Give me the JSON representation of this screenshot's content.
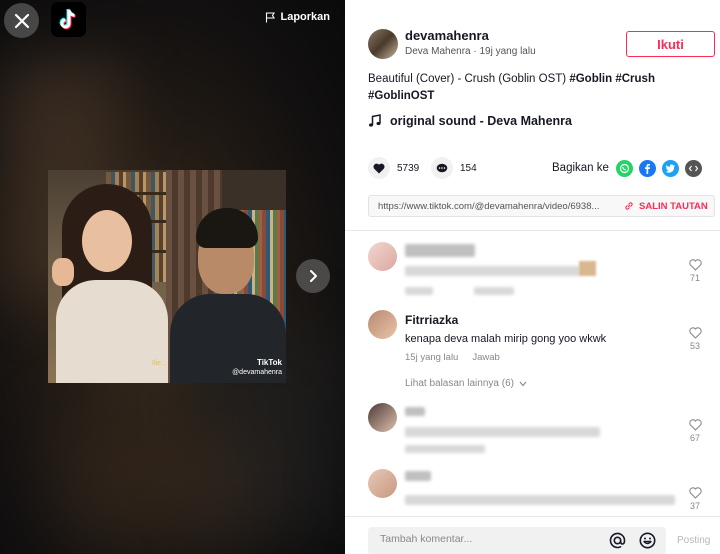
{
  "player": {
    "report_label": "Laporkan",
    "watermark_brand": "TikTok",
    "watermark_handle": "@devamahenra",
    "subtitle": "Ilie..."
  },
  "author": {
    "username": "devamahenra",
    "meta": "Deva Mahenra · 19j yang lalu",
    "follow_label": "Ikuti"
  },
  "description": {
    "text": "Beautiful (Cover) - Crush (Goblin OST)",
    "tags": [
      "#Goblin",
      "#Crush",
      "#GoblinOST"
    ]
  },
  "sound": {
    "title": "original sound - Deva Mahenra"
  },
  "stats": {
    "likes": "5739",
    "comments": "154"
  },
  "share": {
    "label": "Bagikan ke",
    "icons": [
      "whatsapp-icon",
      "facebook-icon",
      "twitter-icon",
      "embed-icon"
    ],
    "colors": {
      "whatsapp": "#25d366",
      "facebook": "#1877f2",
      "twitter": "#1da1f2",
      "embed": "#555555"
    }
  },
  "link": {
    "url": "https://www.tiktok.com/@devamahenra/video/6938...",
    "copy_label": "SALIN TAUTAN"
  },
  "comments": [
    {
      "name": "",
      "text": "",
      "likes": "71",
      "blurred": true
    },
    {
      "name": "Fitrriazka",
      "text": "kenapa deva malah mirip gong yoo wkwk",
      "time": "15j yang lalu",
      "reply_label": "Jawab",
      "likes": "53",
      "more_replies": "Lihat balasan lainnya (6)",
      "blurred": false
    },
    {
      "name": "",
      "text": "",
      "likes": "67",
      "blurred": true
    },
    {
      "name": "",
      "text": "",
      "likes": "37",
      "blurred": true
    }
  ],
  "composer": {
    "placeholder": "Tambah komentar...",
    "post_label": "Posting"
  },
  "colors": {
    "accent": "#fe2c55",
    "text": "#161823"
  }
}
